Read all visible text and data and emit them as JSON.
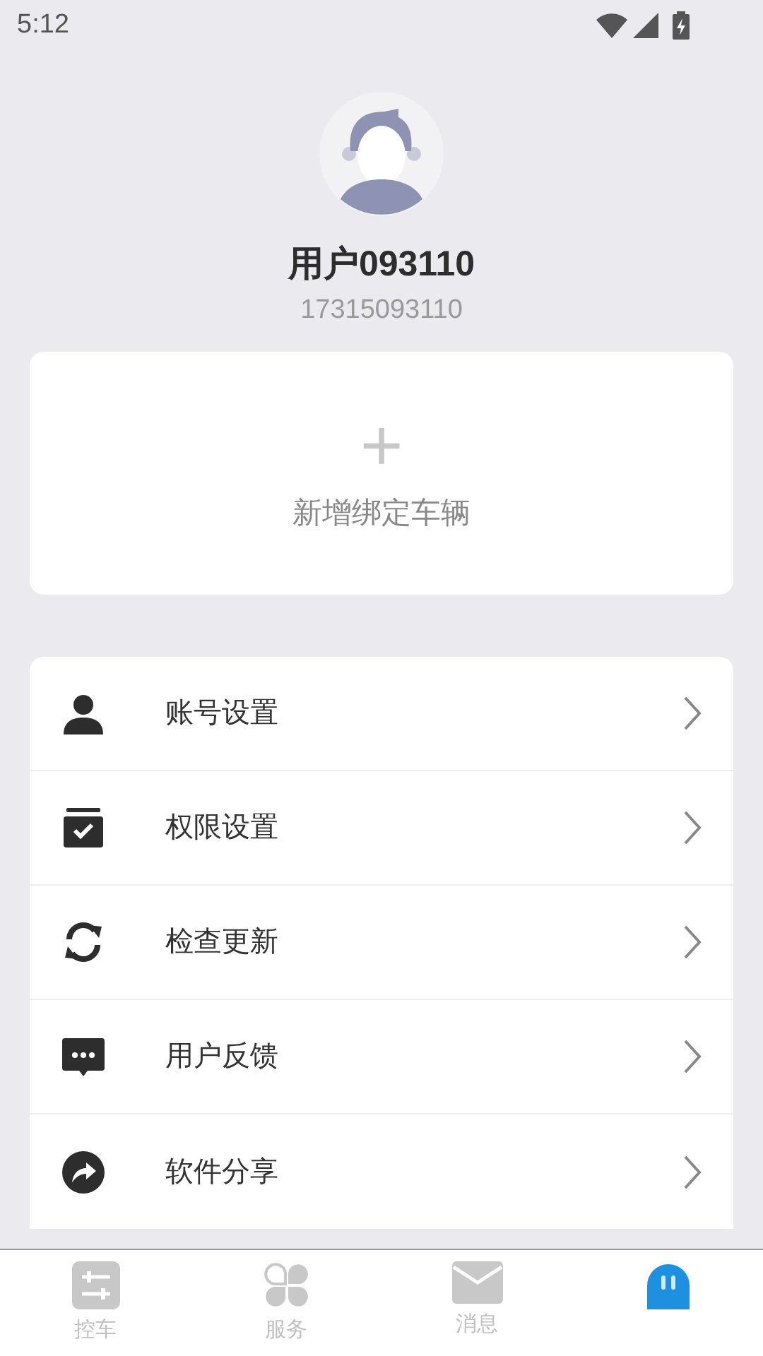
{
  "status_bar": {
    "time": "5:12"
  },
  "profile": {
    "name": "用户093110",
    "phone": "17315093110"
  },
  "add_vehicle": {
    "icon": "+",
    "label": "新增绑定车辆"
  },
  "menu": [
    {
      "kind": "account",
      "label": "账号设置"
    },
    {
      "kind": "permission",
      "label": "权限设置"
    },
    {
      "kind": "update",
      "label": "检查更新"
    },
    {
      "kind": "feedback",
      "label": "用户反馈"
    },
    {
      "kind": "share",
      "label": "软件分享"
    }
  ],
  "tab_bar": [
    {
      "kind": "control",
      "label": "控车",
      "selected": false
    },
    {
      "kind": "service",
      "label": "服务",
      "selected": false
    },
    {
      "kind": "message",
      "label": "消息",
      "selected": false
    },
    {
      "kind": "mine",
      "selected": true
    }
  ]
}
